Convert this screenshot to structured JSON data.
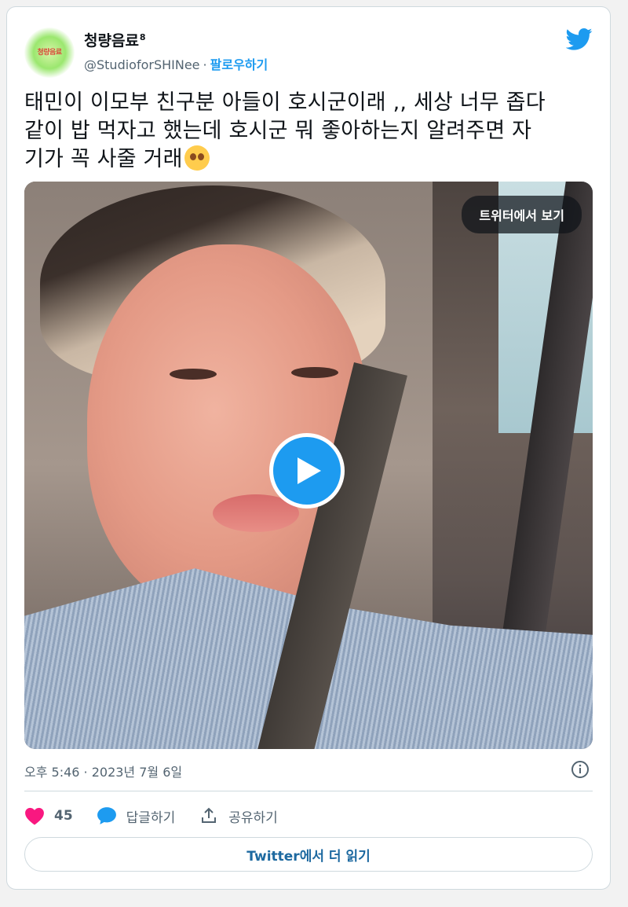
{
  "author": {
    "display_name": "청량음료",
    "badge": "8",
    "handle": "@StudioforSHINee",
    "separator": "·",
    "follow_label": "팔로우하기",
    "avatar_text": "청량음료"
  },
  "tweet": {
    "text_line1": "태민이 이모부 친구분 아들이 호시군이래 ,, 세상 너무 좁다",
    "text_line2": "같이 밥 먹자고 했는데 호시군 뭐 좋아하는지 알려주면 자",
    "text_line3": "기가 꼭 사줄 거래",
    "emoji": "smiling-face-with-heart-eyes"
  },
  "media": {
    "view_on_twitter_label": "트위터에서 보기",
    "play_icon": "play-icon"
  },
  "meta": {
    "timestamp": "오후 5:46 · 2023년 7월 6일"
  },
  "actions": {
    "like_count": "45",
    "reply_label": "답글하기",
    "share_label": "공유하기"
  },
  "footer": {
    "read_more_label": "Twitter에서 더 읽기"
  },
  "colors": {
    "accent": "#1d9bf0",
    "like": "#f91880",
    "muted": "#536471",
    "border": "#cfd9de"
  }
}
